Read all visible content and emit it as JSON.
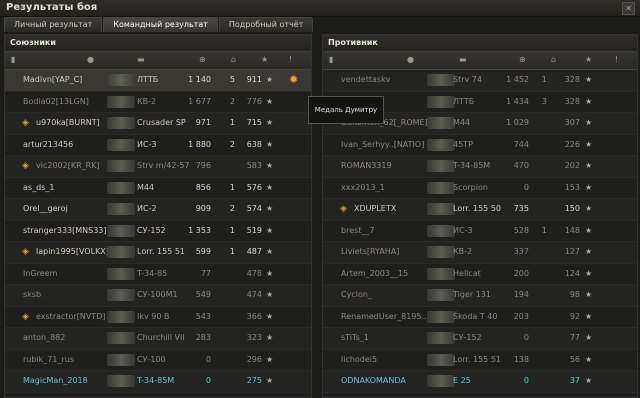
{
  "window": {
    "title": "Результаты боя",
    "close_icon": "close-icon"
  },
  "tabs": [
    {
      "label": "Личный результат"
    },
    {
      "label": "Командный результат"
    },
    {
      "label": "Подробный отчёт"
    }
  ],
  "left": {
    "title": "Союзники",
    "rows": [
      {
        "name": "Madivn[YAP_C]",
        "tank": "ЛТТБ",
        "dmg": "1 140",
        "kills": "5",
        "xp": "911",
        "dead": false,
        "emblem": false
      },
      {
        "name": "Bodia02[13LGN]",
        "tank": "КВ-2",
        "dmg": "1 677",
        "kills": "2",
        "xp": "776",
        "dead": true,
        "emblem": false
      },
      {
        "name": "u970ka[BURNT]",
        "tank": "Crusader SP",
        "dmg": "971",
        "kills": "1",
        "xp": "715",
        "dead": false,
        "emblem": true
      },
      {
        "name": "artur213456",
        "tank": "ИС-3",
        "dmg": "1 880",
        "kills": "2",
        "xp": "638",
        "dead": false,
        "emblem": false
      },
      {
        "name": "vic2002[KR_RK]",
        "tank": "Strv m/42-57",
        "dmg": "796",
        "kills": "",
        "xp": "583",
        "dead": true,
        "emblem": true
      },
      {
        "name": "as_ds_1",
        "tank": "M44",
        "dmg": "856",
        "kills": "1",
        "xp": "576",
        "dead": false,
        "emblem": false
      },
      {
        "name": "Orel__geroj",
        "tank": "ИС-2",
        "dmg": "909",
        "kills": "2",
        "xp": "574",
        "dead": false,
        "emblem": false
      },
      {
        "name": "stranger333[MNS33]",
        "tank": "СУ-152",
        "dmg": "1 353",
        "kills": "1",
        "xp": "519",
        "dead": false,
        "emblem": false
      },
      {
        "name": "lapin1995[VOLKX]",
        "tank": "Lorr. 155 51",
        "dmg": "599",
        "kills": "1",
        "xp": "487",
        "dead": false,
        "emblem": true
      },
      {
        "name": "InGreem",
        "tank": "T-34-85",
        "dmg": "77",
        "kills": "",
        "xp": "478",
        "dead": true,
        "emblem": false
      },
      {
        "name": "sksb",
        "tank": "СУ-100М1",
        "dmg": "549",
        "kills": "",
        "xp": "474",
        "dead": true,
        "emblem": false
      },
      {
        "name": "exstractor[NVTD]",
        "tank": "Ikv 90 B",
        "dmg": "543",
        "kills": "",
        "xp": "366",
        "dead": true,
        "emblem": true
      },
      {
        "name": "anton_882",
        "tank": "Churchill VII",
        "dmg": "283",
        "kills": "",
        "xp": "323",
        "dead": true,
        "emblem": false
      },
      {
        "name": "rubik_71_rus",
        "tank": "СУ-100",
        "dmg": "0",
        "kills": "",
        "xp": "296",
        "dead": true,
        "emblem": false
      },
      {
        "name": "MagicMan_2018",
        "tank": "T-34-85M",
        "dmg": "0",
        "kills": "",
        "xp": "275",
        "dead": false,
        "emblem": false,
        "me": true
      }
    ]
  },
  "right": {
    "title": "Противник",
    "rows": [
      {
        "name": "vendettaskv",
        "tank": "Strv 74",
        "dmg": "1 452",
        "kills": "1",
        "xp": "328",
        "dead": true,
        "emblem": false
      },
      {
        "name": "[YNX4]",
        "tank": "ЛТТБ",
        "dmg": "1 434",
        "kills": "3",
        "xp": "328",
        "dead": true,
        "emblem": false
      },
      {
        "name": "diskomen_62[_ROME]",
        "tank": "M44",
        "dmg": "1 029",
        "kills": "",
        "xp": "307",
        "dead": true,
        "emblem": false
      },
      {
        "name": "Ivan_Serhyy..[NATIO]",
        "tank": "45TP",
        "dmg": "744",
        "kills": "",
        "xp": "226",
        "dead": true,
        "emblem": false
      },
      {
        "name": "ROMAN3319",
        "tank": "T-34-85M",
        "dmg": "470",
        "kills": "",
        "xp": "202",
        "dead": true,
        "emblem": false
      },
      {
        "name": "xxx2013_1",
        "tank": "Scorpion",
        "dmg": "0",
        "kills": "",
        "xp": "153",
        "dead": true,
        "emblem": false
      },
      {
        "name": "XDUPLETX",
        "tank": "Lorr. 155 50",
        "dmg": "735",
        "kills": "",
        "xp": "150",
        "dead": false,
        "emblem": true
      },
      {
        "name": "brest__7",
        "tank": "ИС-3",
        "dmg": "528",
        "kills": "1",
        "xp": "148",
        "dead": true,
        "emblem": false
      },
      {
        "name": "Liviets[RYAHA]",
        "tank": "КВ-2",
        "dmg": "337",
        "kills": "",
        "xp": "127",
        "dead": true,
        "emblem": false
      },
      {
        "name": "Artem_2003__15",
        "tank": "Hellcat",
        "dmg": "200",
        "kills": "",
        "xp": "124",
        "dead": true,
        "emblem": false
      },
      {
        "name": "Cyclon_",
        "tank": "Tiger 131",
        "dmg": "194",
        "kills": "",
        "xp": "98",
        "dead": true,
        "emblem": false
      },
      {
        "name": "RenamedUser_8195..",
        "tank": "Škoda T 40",
        "dmg": "203",
        "kills": "",
        "xp": "92",
        "dead": true,
        "emblem": false
      },
      {
        "name": "sTiTs_1",
        "tank": "СУ-152",
        "dmg": "0",
        "kills": "",
        "xp": "77",
        "dead": true,
        "emblem": false
      },
      {
        "name": "lichodei5",
        "tank": "Lorr. 155 51",
        "dmg": "138",
        "kills": "",
        "xp": "56",
        "dead": true,
        "emblem": false
      },
      {
        "name": "ODNAKOMANDA",
        "tank": "E 25",
        "dmg": "0",
        "kills": "",
        "xp": "37",
        "dead": true,
        "emblem": false,
        "me": true
      }
    ]
  },
  "tooltip": "Медаль Думитру",
  "colors": {
    "accent": "#5fc8d6",
    "medal": "#e0a43a"
  }
}
